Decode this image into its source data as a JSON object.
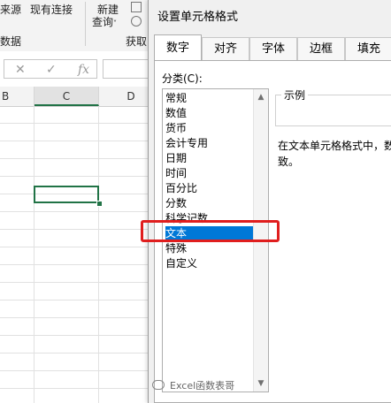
{
  "excel": {
    "ribbon": {
      "from_source": "来源",
      "existing_connections": "现有连接",
      "new_query_line1": "新建",
      "new_query_line2": "查询",
      "data_fragment": "数据",
      "get_transform_fragment": "获取"
    },
    "formula_bar": {
      "cancel_glyph": "✕",
      "enter_glyph": "✓",
      "fx_label": "fx"
    },
    "columns": [
      "B",
      "C",
      "D"
    ]
  },
  "dialog": {
    "title": "设置单元格格式",
    "tabs": [
      {
        "label": "数字",
        "active": true
      },
      {
        "label": "对齐",
        "active": false
      },
      {
        "label": "字体",
        "active": false
      },
      {
        "label": "边框",
        "active": false
      },
      {
        "label": "填充",
        "active": false
      }
    ],
    "category_label": "分类(C):",
    "categories": [
      {
        "label": "常规",
        "selected": false
      },
      {
        "label": "数值",
        "selected": false
      },
      {
        "label": "货币",
        "selected": false
      },
      {
        "label": "会计专用",
        "selected": false
      },
      {
        "label": "日期",
        "selected": false
      },
      {
        "label": "时间",
        "selected": false
      },
      {
        "label": "百分比",
        "selected": false
      },
      {
        "label": "分数",
        "selected": false
      },
      {
        "label": "科学记数",
        "selected": false
      },
      {
        "label": "文本",
        "selected": true
      },
      {
        "label": "特殊",
        "selected": false
      },
      {
        "label": "自定义",
        "selected": false
      }
    ],
    "sample_label": "示例",
    "description": "在文本单元格格式中，数 致。",
    "highlight_color": "#e01e1e",
    "selection_color": "#0078d7"
  },
  "watermark": "Excel函数表哥"
}
